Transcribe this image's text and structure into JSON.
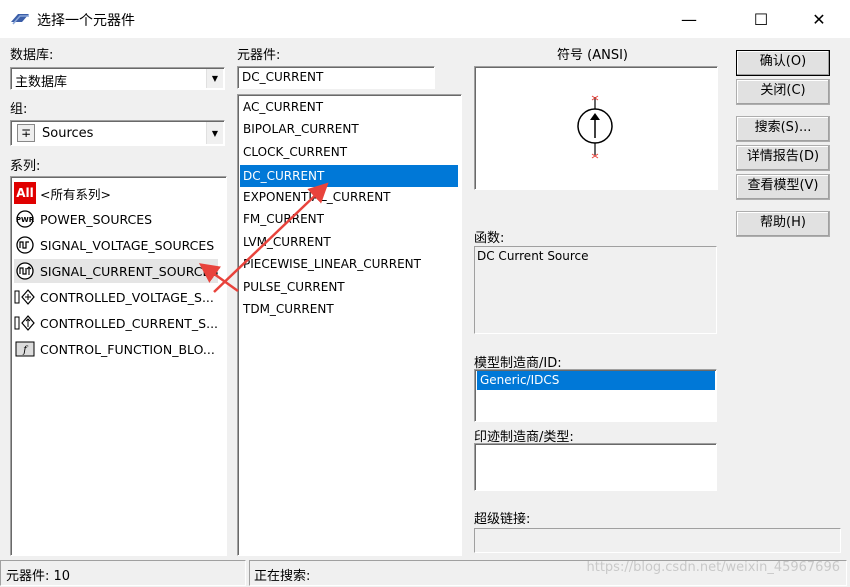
{
  "window": {
    "title": "选择一个元器件",
    "minimize": "—",
    "maximize": "☐",
    "close": "✕"
  },
  "database": {
    "label": "数据库:",
    "value": "主数据库"
  },
  "group": {
    "label": "组:",
    "value": "Sources"
  },
  "family": {
    "label": "系列:",
    "items": [
      {
        "icon": "All",
        "label": "<所有系列>"
      },
      {
        "icon": "power-icon",
        "label": "POWER_SOURCES"
      },
      {
        "icon": "signal-voltage-icon",
        "label": "SIGNAL_VOLTAGE_SOURCES"
      },
      {
        "icon": "signal-current-icon",
        "label": "SIGNAL_CURRENT_SOURCES"
      },
      {
        "icon": "controlled-voltage-icon",
        "label": "CONTROLLED_VOLTAGE_S..."
      },
      {
        "icon": "controlled-current-icon",
        "label": "CONTROLLED_CURRENT_S..."
      },
      {
        "icon": "control-function-icon",
        "label": "CONTROL_FUNCTION_BLO..."
      }
    ]
  },
  "component": {
    "label": "元器件:",
    "search_value": "DC_CURRENT",
    "items": [
      "AC_CURRENT",
      "BIPOLAR_CURRENT",
      "CLOCK_CURRENT",
      "DC_CURRENT",
      "EXPONENTIAL_CURRENT",
      "FM_CURRENT",
      "LVM_CURRENT",
      "PIECEWISE_LINEAR_CURRENT",
      "PULSE_CURRENT",
      "TDM_CURRENT"
    ],
    "selected": "DC_CURRENT"
  },
  "symbol": {
    "label": "符号 (ANSI)"
  },
  "function": {
    "label": "函数:",
    "value": "DC Current Source"
  },
  "model": {
    "label": "模型制造商/ID:",
    "items": [
      "Generic/IDCS"
    ]
  },
  "footprint": {
    "label": "印迹制造商/类型:"
  },
  "hyperlink": {
    "label": "超级链接:"
  },
  "buttons": {
    "ok": "确认(O)",
    "close": "关闭(C)",
    "search": "搜索(S)...",
    "detail": "详情报告(D)",
    "view_model": "查看模型(V)",
    "help": "帮助(H)"
  },
  "status": {
    "count": "元器件: 10",
    "searching": "正在搜索:"
  },
  "watermark": "https://blog.csdn.net/weixin_45967696",
  "colors": {
    "selection": "#0078d7",
    "arrow": "#e8433c"
  }
}
